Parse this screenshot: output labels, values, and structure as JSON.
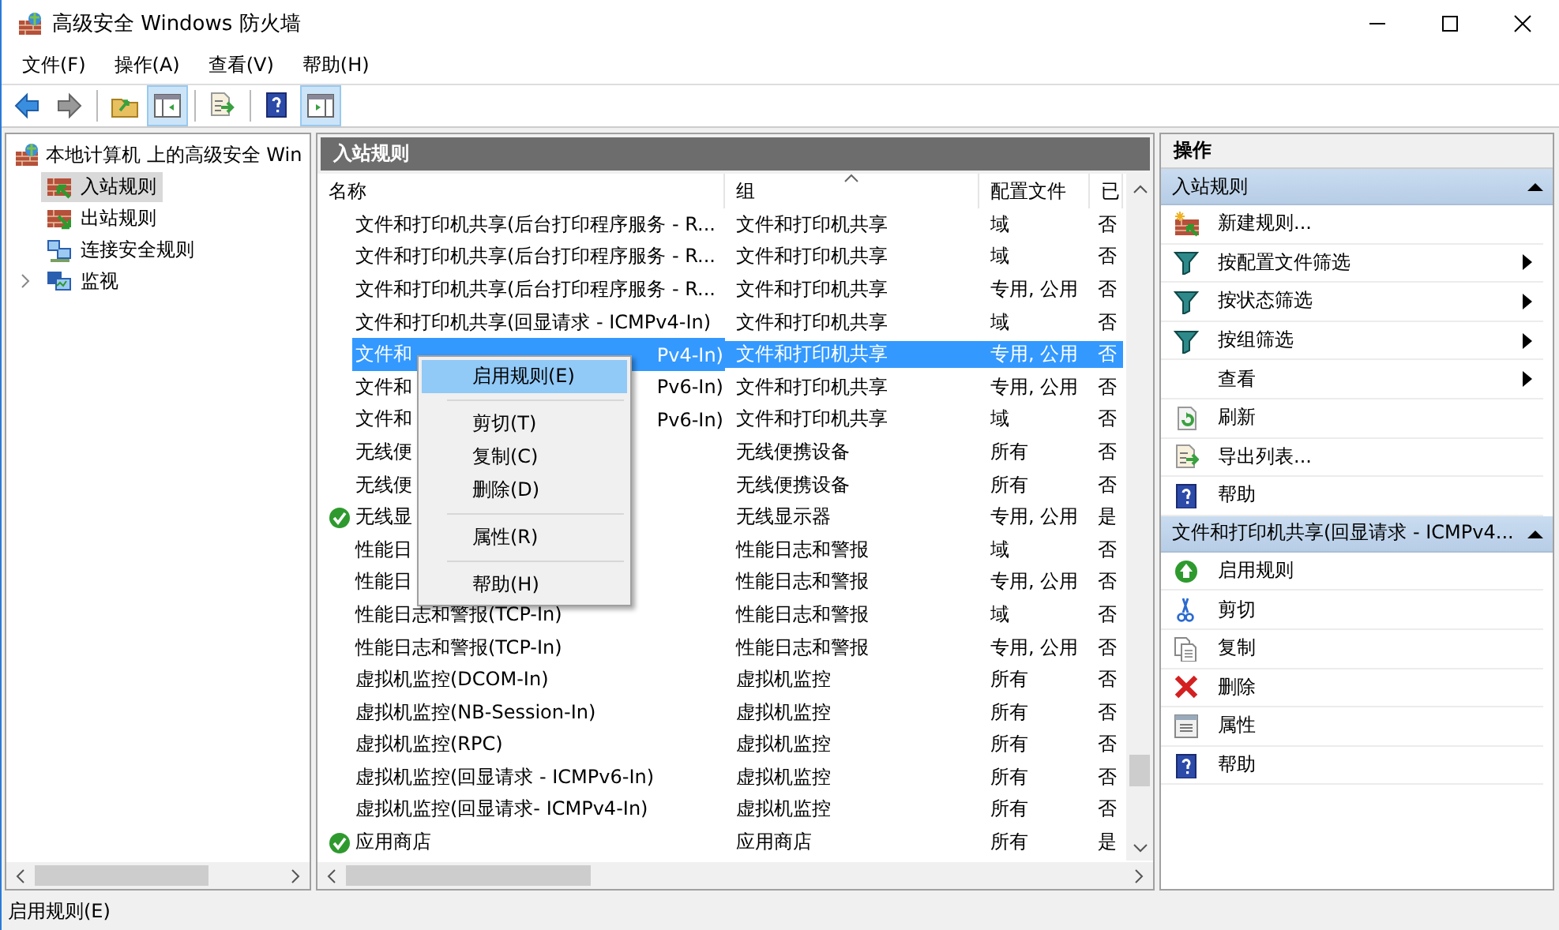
{
  "window": {
    "title": "高级安全 Windows 防火墙"
  },
  "menu": [
    "文件(F)",
    "操作(A)",
    "查看(V)",
    "帮助(H)"
  ],
  "toolbar": [
    {
      "pressed": false
    },
    {
      "pressed": false
    },
    {
      "pressed": false
    },
    {
      "pressed": true
    },
    {
      "pressed": false
    },
    {
      "pressed": false
    },
    {
      "pressed": true
    }
  ],
  "tree": {
    "label": "本地计算机 上的高级安全 Win",
    "children": [
      {
        "label": "入站规则",
        "selected": true
      },
      {
        "label": "出站规则",
        "selected": false
      },
      {
        "label": "连接安全规则",
        "selected": false
      },
      {
        "label": "监视",
        "selected": false,
        "expanded": false
      }
    ]
  },
  "content": {
    "title": "入站规则",
    "columns": [
      {
        "label": "名称",
        "sorted": false
      },
      {
        "label": "组",
        "sorted": true
      },
      {
        "label": "配置文件",
        "sorted": false
      },
      {
        "label": "已",
        "sorted": false
      }
    ],
    "rows": [
      {
        "name": "文件和打印机共享(后台打印程序服务 - R...",
        "group": "文件和打印机共享",
        "profile": "域",
        "column_4": "否",
        "enabled": false,
        "selected": false
      },
      {
        "name": "文件和打印机共享(后台打印程序服务 - R...",
        "group": "文件和打印机共享",
        "profile": "域",
        "column_4": "否",
        "enabled": false,
        "selected": false
      },
      {
        "name": "文件和打印机共享(后台打印程序服务 - R...",
        "group": "文件和打印机共享",
        "profile": "专用, 公用",
        "column_4": "否",
        "enabled": false,
        "selected": false
      },
      {
        "name": "文件和打印机共享(回显请求 - ICMPv4-In)",
        "group": "文件和打印机共享",
        "profile": "域",
        "column_4": "否",
        "enabled": false,
        "selected": false
      },
      {
        "name": "文件和",
        "name_tail": "Pv4-In)",
        "group": "文件和打印机共享",
        "profile": "专用, 公用",
        "column_4": "否",
        "enabled": false,
        "selected": true
      },
      {
        "name": "文件和",
        "name_tail": "Pv6-In)",
        "group": "文件和打印机共享",
        "profile": "专用, 公用",
        "column_4": "否",
        "enabled": false,
        "selected": false
      },
      {
        "name": "文件和",
        "name_tail": "Pv6-In)",
        "group": "文件和打印机共享",
        "profile": "域",
        "column_4": "否",
        "enabled": false,
        "selected": false
      },
      {
        "name": "无线便",
        "group": "无线便携设备",
        "profile": "所有",
        "column_4": "否",
        "enabled": false,
        "selected": false
      },
      {
        "name": "无线便",
        "group": "无线便携设备",
        "profile": "所有",
        "column_4": "否",
        "enabled": false,
        "selected": false
      },
      {
        "name": "无线显",
        "group": "无线显示器",
        "profile": "专用, 公用",
        "column_4": "是",
        "enabled": true,
        "selected": false
      },
      {
        "name": "性能日",
        "group": "性能日志和警报",
        "profile": "域",
        "column_4": "否",
        "enabled": false,
        "selected": false
      },
      {
        "name": "性能日",
        "group": "性能日志和警报",
        "profile": "专用, 公用",
        "column_4": "否",
        "enabled": false,
        "selected": false
      },
      {
        "name": "性能日志和警报(TCP-In)",
        "group": "性能日志和警报",
        "profile": "域",
        "column_4": "否",
        "enabled": false,
        "selected": false
      },
      {
        "name": "性能日志和警报(TCP-In)",
        "group": "性能日志和警报",
        "profile": "专用, 公用",
        "column_4": "否",
        "enabled": false,
        "selected": false
      },
      {
        "name": "虚拟机监控(DCOM-In)",
        "group": "虚拟机监控",
        "profile": "所有",
        "column_4": "否",
        "enabled": false,
        "selected": false
      },
      {
        "name": "虚拟机监控(NB-Session-In)",
        "group": "虚拟机监控",
        "profile": "所有",
        "column_4": "否",
        "enabled": false,
        "selected": false
      },
      {
        "name": "虚拟机监控(RPC)",
        "group": "虚拟机监控",
        "profile": "所有",
        "column_4": "否",
        "enabled": false,
        "selected": false
      },
      {
        "name": "虚拟机监控(回显请求 - ICMPv6-In)",
        "group": "虚拟机监控",
        "profile": "所有",
        "column_4": "否",
        "enabled": false,
        "selected": false
      },
      {
        "name": "虚拟机监控(回显请求- ICMPv4-In)",
        "group": "虚拟机监控",
        "profile": "所有",
        "column_4": "否",
        "enabled": false,
        "selected": false
      },
      {
        "name": "应用商店",
        "group": "应用商店",
        "profile": "所有",
        "column_4": "是",
        "enabled": true,
        "selected": false
      }
    ]
  },
  "context_menu": [
    {
      "kind": "item",
      "label": "启用规则(E)",
      "selected": true
    },
    {
      "kind": "separator"
    },
    {
      "kind": "item",
      "label": "剪切(T)",
      "selected": false
    },
    {
      "kind": "item",
      "label": "复制(C)",
      "selected": false
    },
    {
      "kind": "item",
      "label": "删除(D)",
      "selected": false
    },
    {
      "kind": "separator"
    },
    {
      "kind": "item",
      "label": "属性(R)",
      "selected": false
    },
    {
      "kind": "separator"
    },
    {
      "kind": "item",
      "label": "帮助(H)",
      "selected": false
    }
  ],
  "actions": {
    "title": "操作",
    "sections": [
      {
        "title": "入站规则",
        "expanded": true,
        "items": [
          {
            "label": "新建规则...",
            "submenu": false
          },
          {
            "label": "按配置文件筛选",
            "submenu": true
          },
          {
            "label": "按状态筛选",
            "submenu": true
          },
          {
            "label": "按组筛选",
            "submenu": true
          },
          {
            "label": "查看",
            "submenu": true
          },
          {
            "label": "刷新",
            "submenu": false
          },
          {
            "label": "导出列表...",
            "submenu": false
          },
          {
            "label": "帮助",
            "submenu": false
          }
        ]
      },
      {
        "title": "文件和打印机共享(回显请求 - ICMPv4...",
        "expanded": true,
        "items": [
          {
            "label": "启用规则",
            "submenu": false
          },
          {
            "label": "剪切",
            "submenu": false
          },
          {
            "label": "复制",
            "submenu": false
          },
          {
            "label": "删除",
            "submenu": false
          },
          {
            "label": "属性",
            "submenu": false
          },
          {
            "label": "帮助",
            "submenu": false
          }
        ]
      }
    ]
  },
  "status_bar": "启用规则(E)"
}
